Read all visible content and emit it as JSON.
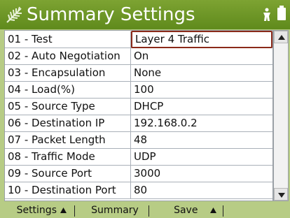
{
  "header": {
    "title": "Summary Settings",
    "logo_icon": "feather-logo-icon",
    "status_icons": [
      "person-icon",
      "battery-icon"
    ]
  },
  "settings": [
    {
      "key": "01 - Test",
      "value": "Layer 4 Traffic",
      "selected": true
    },
    {
      "key": "02 - Auto Negotiation",
      "value": "On"
    },
    {
      "key": "03 - Encapsulation",
      "value": "None"
    },
    {
      "key": "04 - Load(%)",
      "value": "100"
    },
    {
      "key": "05 - Source Type",
      "value": "DHCP"
    },
    {
      "key": "06 - Destination IP",
      "value": "192.168.0.2"
    },
    {
      "key": "07 - Packet Length",
      "value": "48"
    },
    {
      "key": "08 - Traffic Mode",
      "value": "UDP"
    },
    {
      "key": "09 - Source Port",
      "value": "3000"
    },
    {
      "key": "10 - Destination Port",
      "value": "80"
    }
  ],
  "softkeys": {
    "settings": "Settings",
    "summary": "Summary",
    "save": "Save"
  },
  "colors": {
    "title_bar": "#6a9424",
    "background": "#b7cc85",
    "selection_border": "#8a2a1a"
  }
}
